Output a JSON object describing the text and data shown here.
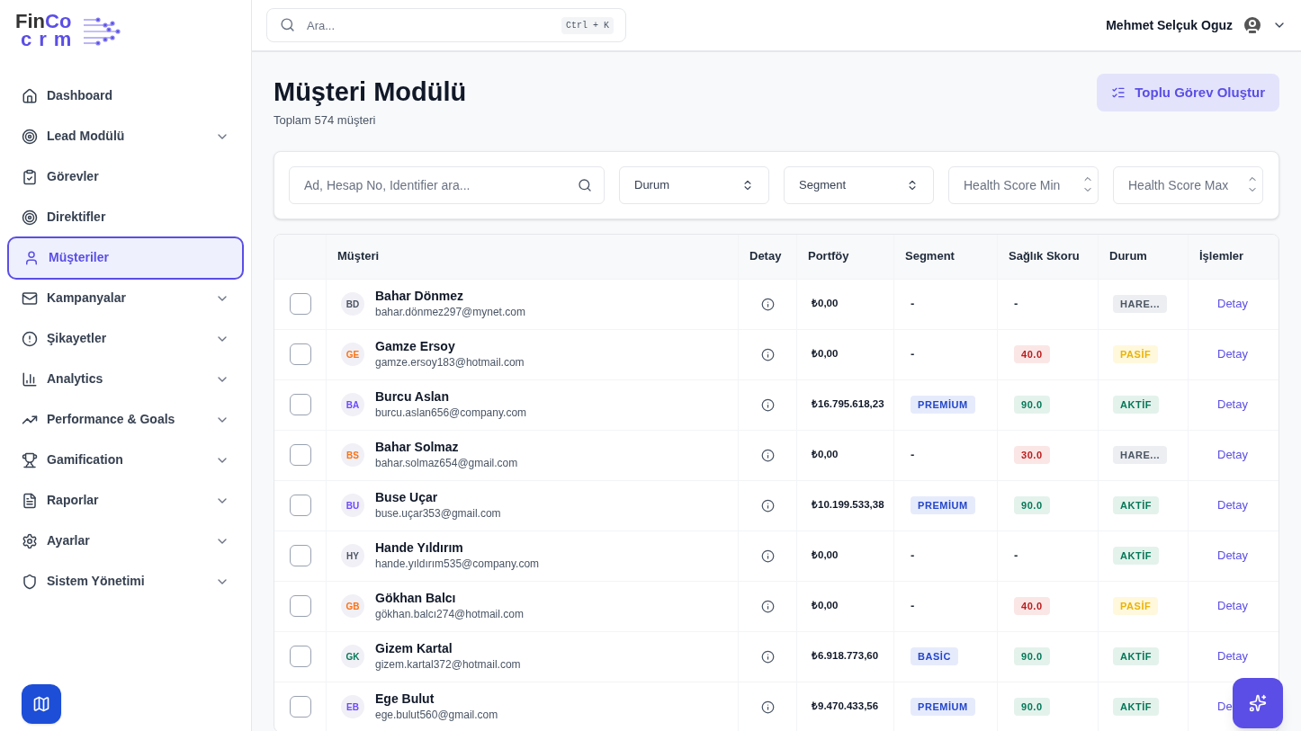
{
  "logo": {
    "main": "Fin",
    "accent": "Co",
    "sub": "crm"
  },
  "sidebar": {
    "items": [
      {
        "label": "Dashboard",
        "selected": false,
        "expandable": false
      },
      {
        "label": "Lead Modülü",
        "selected": false,
        "expandable": true
      },
      {
        "label": "Görevler",
        "selected": false,
        "expandable": false
      },
      {
        "label": "Direktifler",
        "selected": false,
        "expandable": false
      },
      {
        "label": "Müşteriler",
        "selected": true,
        "expandable": false
      },
      {
        "label": "Kampanyalar",
        "selected": false,
        "expandable": true
      },
      {
        "label": "Şikayetler",
        "selected": false,
        "expandable": true
      },
      {
        "label": "Analytics",
        "selected": false,
        "expandable": true
      },
      {
        "label": "Performance & Goals",
        "selected": false,
        "expandable": true
      },
      {
        "label": "Gamification",
        "selected": false,
        "expandable": true
      },
      {
        "label": "Raporlar",
        "selected": false,
        "expandable": true
      },
      {
        "label": "Ayarlar",
        "selected": false,
        "expandable": true
      },
      {
        "label": "Sistem Yönetimi",
        "selected": false,
        "expandable": true
      }
    ]
  },
  "topbar": {
    "search": {
      "placeholder": "Ara...",
      "shortcut": "Ctrl + K"
    },
    "user": "Mehmet Selçuk Oguz"
  },
  "page": {
    "title": "Müşteri Modülü",
    "subtitle": "Toplam 574 müşteri",
    "action": "Toplu Görev Oluştur"
  },
  "filters": {
    "search": {
      "placeholder": "Ad, Hesap No, Identifier ara..."
    },
    "selects": [
      "Durum",
      "Segment"
    ],
    "numbers": [
      {
        "placeholder": "Health Score Min"
      },
      {
        "placeholder": "Health Score Max"
      }
    ]
  },
  "table": {
    "columns": [
      "Müşteri",
      "Detay",
      "Portföy",
      "Segment",
      "Sağlık Skoru",
      "Durum",
      "İşlemler"
    ],
    "rows": [
      {
        "checked": false,
        "initials": "BD",
        "color": "#4b5563",
        "name": "Bahar Dönmez",
        "email": "bahar.dönmez297@mynet.com",
        "portfolio": "₺0,00",
        "segment": {
          "kind": "none",
          "label": "-"
        },
        "score": {
          "kind": "none",
          "label": "-"
        },
        "status": {
          "kind": "idle",
          "label": "HARE..."
        },
        "action": "Detay"
      },
      {
        "checked": false,
        "initials": "GE",
        "color": "#f97316",
        "name": "Gamze Ersoy",
        "email": "gamze.ersoy183@hotmail.com",
        "portfolio": "₺0,00",
        "segment": {
          "kind": "none",
          "label": "-"
        },
        "score": {
          "kind": "low",
          "label": "40.0"
        },
        "status": {
          "kind": "passive",
          "label": "PASİF"
        },
        "action": "Detay"
      },
      {
        "checked": false,
        "initials": "BA",
        "color": "#6d4aff",
        "name": "Burcu Aslan",
        "email": "burcu.aslan656@company.com",
        "portfolio": "₺16.795.618,23",
        "segment": {
          "kind": "premium",
          "label": "PREMİUM"
        },
        "score": {
          "kind": "high",
          "label": "90.0"
        },
        "status": {
          "kind": "active",
          "label": "AKTİF"
        },
        "action": "Detay"
      },
      {
        "checked": false,
        "initials": "BS",
        "color": "#f97316",
        "name": "Bahar Solmaz",
        "email": "bahar.solmaz654@gmail.com",
        "portfolio": "₺0,00",
        "segment": {
          "kind": "none",
          "label": "-"
        },
        "score": {
          "kind": "low",
          "label": "30.0"
        },
        "status": {
          "kind": "idle",
          "label": "HARE..."
        },
        "action": "Detay"
      },
      {
        "checked": false,
        "initials": "BU",
        "color": "#6d4aff",
        "name": "Buse Uçar",
        "email": "buse.uçar353@gmail.com",
        "portfolio": "₺10.199.533,38",
        "segment": {
          "kind": "premium",
          "label": "PREMİUM"
        },
        "score": {
          "kind": "high",
          "label": "90.0"
        },
        "status": {
          "kind": "active",
          "label": "AKTİF"
        },
        "action": "Detay"
      },
      {
        "checked": false,
        "initials": "HY",
        "color": "#4b5563",
        "name": "Hande Yıldırım",
        "email": "hande.yıldırım535@company.com",
        "portfolio": "₺0,00",
        "segment": {
          "kind": "none",
          "label": "-"
        },
        "score": {
          "kind": "none",
          "label": "-"
        },
        "status": {
          "kind": "active",
          "label": "AKTİF"
        },
        "action": "Detay"
      },
      {
        "checked": false,
        "initials": "GB",
        "color": "#f97316",
        "name": "Gökhan Balcı",
        "email": "gökhan.balcı274@hotmail.com",
        "portfolio": "₺0,00",
        "segment": {
          "kind": "none",
          "label": "-"
        },
        "score": {
          "kind": "low",
          "label": "40.0"
        },
        "status": {
          "kind": "passive",
          "label": "PASİF"
        },
        "action": "Detay"
      },
      {
        "checked": false,
        "initials": "GK",
        "color": "#047857",
        "name": "Gizem Kartal",
        "email": "gizem.kartal372@hotmail.com",
        "portfolio": "₺6.918.773,60",
        "segment": {
          "kind": "basic",
          "label": "BASİC"
        },
        "score": {
          "kind": "high",
          "label": "90.0"
        },
        "status": {
          "kind": "active",
          "label": "AKTİF"
        },
        "action": "Detay"
      },
      {
        "checked": false,
        "initials": "EB",
        "color": "#6d4aff",
        "name": "Ege Bulut",
        "email": "ege.bulut560@gmail.com",
        "portfolio": "₺9.470.433,56",
        "segment": {
          "kind": "premium",
          "label": "PREMİUM"
        },
        "score": {
          "kind": "high",
          "label": "90.0"
        },
        "status": {
          "kind": "active",
          "label": "AKTİF"
        },
        "action": "De"
      }
    ]
  }
}
